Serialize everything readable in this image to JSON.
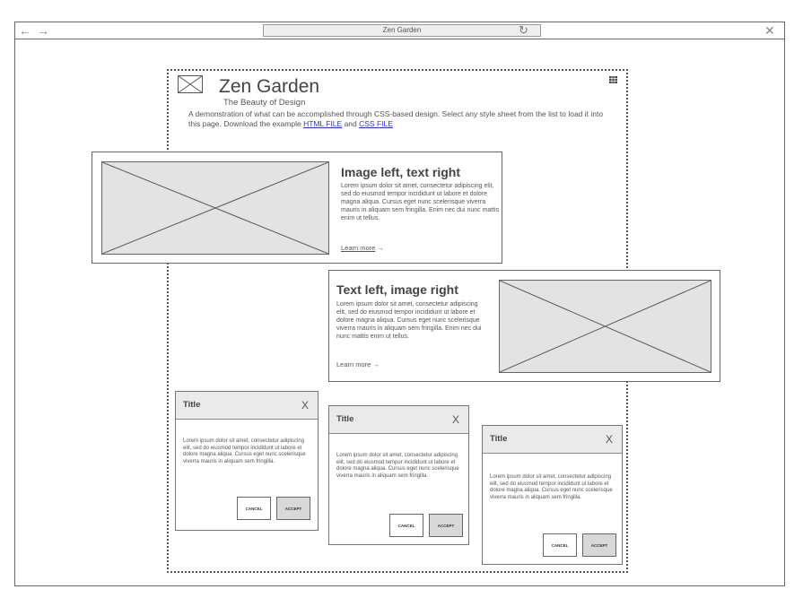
{
  "browser": {
    "back_icon": "←",
    "forward_icon": "→",
    "address": "Zen Garden",
    "reload_icon": "↻",
    "close_icon": "✕"
  },
  "header": {
    "title": "Zen Garden",
    "subtitle": "The Beauty of Design",
    "desc_1": "A demonstration of what can be accomplished through CSS-based design. Select any style sheet from the list to load it into this page. Download the example ",
    "link_html": "HTML FILE",
    "and": " and ",
    "link_css": "CSS FILE"
  },
  "card1": {
    "title": "Image left, text right",
    "body": "Lorem ipsum dolor sit amet, consectetur adipiscing elit, sed do eiusmod tempor incididunt ut labore et dolore magna aliqua. Cursus eget nunc scelerisque viverra mauris in aliquam sem fringilla. Enim nec dui nunc mattis enim ut tellus.",
    "link": "Learn more",
    "arrow": "→"
  },
  "card2": {
    "title": "Text left, image right",
    "body": "Lorem ipsum dolor sit amet, consectetur adipiscing elit, sed do eiusmod tempor incididunt ut labore et dolore magna aliqua. Cursus eget nunc scelerisque viverra mauris in aliquam sem fringilla. Enim nec dui nunc mattis enim ut tellus.",
    "link": "Learn more",
    "arrow": "→"
  },
  "dialogs": [
    {
      "title": "Title",
      "close": "X",
      "body": "Lorem ipsum dolor sit amet, consectetur adipiscing elit, sed do eiusmod tempor incididunt ut labore et dolore magna aliqua. Cursus eget nunc scelerisque viverra mauris in aliquam sem fringilla.",
      "cancel": "CANCEL",
      "accept": "ACCEPT"
    },
    {
      "title": "Title",
      "close": "X",
      "body": "Lorem ipsum dolor sit amet, consectetur adipiscing elit, sed do eiusmod tempor incididunt ut labore et dolore magna aliqua. Cursus eget nunc scelerisque viverra mauris in aliquam sem fringilla.",
      "cancel": "CANCEL",
      "accept": "ACCEPT"
    },
    {
      "title": "Title",
      "close": "X",
      "body": "Lorem ipsum dolor sit amet, consectetur adipiscing elit, sed do eiusmod tempor incididunt ut labore et dolore magna aliqua. Cursus eget nunc scelerisque viverra mauris in aliquam sem fringilla.",
      "cancel": "CANCEL",
      "accept": "ACCEPT"
    }
  ]
}
